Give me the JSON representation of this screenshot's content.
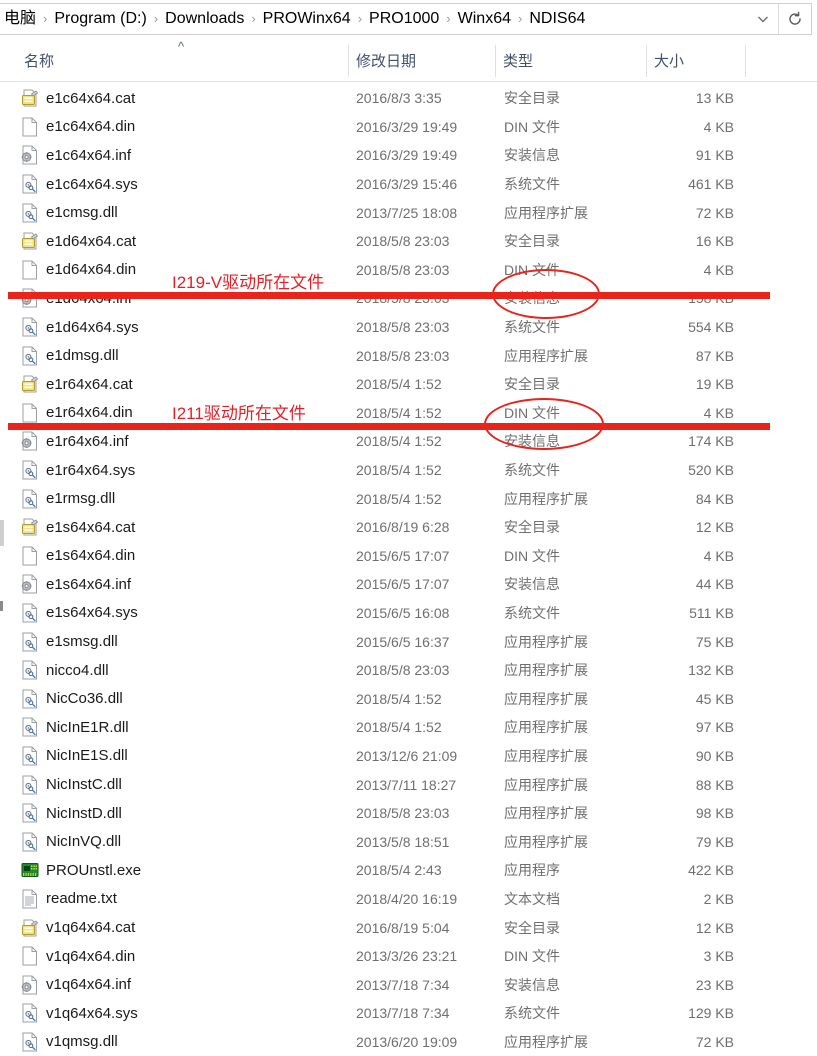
{
  "window": {
    "title": "NDIS64",
    "addressbar": {
      "crumbs": [
        "电脑",
        "Program (D:)",
        "Downloads",
        "PROWinx64",
        "PRO1000",
        "Winx64",
        "NDIS64"
      ],
      "separator": "›",
      "chevron_icon": "chevron-down-icon",
      "refresh_icon": "refresh-icon",
      "refresh_glyph": "↻",
      "chevron_glyph": "⌄"
    }
  },
  "columns": {
    "headers": [
      {
        "label": "名称",
        "key": "name"
      },
      {
        "label": "修改日期",
        "key": "date"
      },
      {
        "label": "类型",
        "key": "type"
      },
      {
        "label": "大小",
        "key": "size"
      }
    ],
    "sort_indicator": "^",
    "sorted_by": "名称",
    "sort_direction": "ascending"
  },
  "files": [
    {
      "name": "e1c64x64.cat",
      "date": "2016/8/3 3:35",
      "type": "安全目录",
      "size": "13 KB",
      "icon": "catalog-file-icon"
    },
    {
      "name": "e1c64x64.din",
      "date": "2016/3/29 19:49",
      "type": "DIN 文件",
      "size": "4 KB",
      "icon": "blank-file-icon"
    },
    {
      "name": "e1c64x64.inf",
      "date": "2016/3/29 19:49",
      "type": "安装信息",
      "size": "91 KB",
      "icon": "setup-info-file-icon"
    },
    {
      "name": "e1c64x64.sys",
      "date": "2016/3/29 15:46",
      "type": "系统文件",
      "size": "461 KB",
      "icon": "system-file-icon"
    },
    {
      "name": "e1cmsg.dll",
      "date": "2013/7/25 18:08",
      "type": "应用程序扩展",
      "size": "72 KB",
      "icon": "system-file-icon"
    },
    {
      "name": "e1d64x64.cat",
      "date": "2018/5/8 23:03",
      "type": "安全目录",
      "size": "16 KB",
      "icon": "catalog-file-icon"
    },
    {
      "name": "e1d64x64.din",
      "date": "2018/5/8 23:03",
      "type": "DIN 文件",
      "size": "4 KB",
      "icon": "blank-file-icon"
    },
    {
      "name": "e1d64x64.inf",
      "date": "2018/5/8 23:03",
      "type": "安装信息",
      "size": "158 KB",
      "icon": "setup-info-file-icon"
    },
    {
      "name": "e1d64x64.sys",
      "date": "2018/5/8 23:03",
      "type": "系统文件",
      "size": "554 KB",
      "icon": "system-file-icon"
    },
    {
      "name": "e1dmsg.dll",
      "date": "2018/5/8 23:03",
      "type": "应用程序扩展",
      "size": "87 KB",
      "icon": "system-file-icon"
    },
    {
      "name": "e1r64x64.cat",
      "date": "2018/5/4 1:52",
      "type": "安全目录",
      "size": "19 KB",
      "icon": "catalog-file-icon"
    },
    {
      "name": "e1r64x64.din",
      "date": "2018/5/4 1:52",
      "type": "DIN 文件",
      "size": "4 KB",
      "icon": "blank-file-icon"
    },
    {
      "name": "e1r64x64.inf",
      "date": "2018/5/4 1:52",
      "type": "安装信息",
      "size": "174 KB",
      "icon": "setup-info-file-icon"
    },
    {
      "name": "e1r64x64.sys",
      "date": "2018/5/4 1:52",
      "type": "系统文件",
      "size": "520 KB",
      "icon": "system-file-icon"
    },
    {
      "name": "e1rmsg.dll",
      "date": "2018/5/4 1:52",
      "type": "应用程序扩展",
      "size": "84 KB",
      "icon": "system-file-icon"
    },
    {
      "name": "e1s64x64.cat",
      "date": "2016/8/19 6:28",
      "type": "安全目录",
      "size": "12 KB",
      "icon": "catalog-file-icon"
    },
    {
      "name": "e1s64x64.din",
      "date": "2015/6/5 17:07",
      "type": "DIN 文件",
      "size": "4 KB",
      "icon": "blank-file-icon"
    },
    {
      "name": "e1s64x64.inf",
      "date": "2015/6/5 17:07",
      "type": "安装信息",
      "size": "44 KB",
      "icon": "setup-info-file-icon"
    },
    {
      "name": "e1s64x64.sys",
      "date": "2015/6/5 16:08",
      "type": "系统文件",
      "size": "511 KB",
      "icon": "system-file-icon"
    },
    {
      "name": "e1smsg.dll",
      "date": "2015/6/5 16:37",
      "type": "应用程序扩展",
      "size": "75 KB",
      "icon": "system-file-icon"
    },
    {
      "name": "nicco4.dll",
      "date": "2018/5/8 23:03",
      "type": "应用程序扩展",
      "size": "132 KB",
      "icon": "system-file-icon"
    },
    {
      "name": "NicCo36.dll",
      "date": "2018/5/4 1:52",
      "type": "应用程序扩展",
      "size": "45 KB",
      "icon": "system-file-icon"
    },
    {
      "name": "NicInE1R.dll",
      "date": "2018/5/4 1:52",
      "type": "应用程序扩展",
      "size": "97 KB",
      "icon": "system-file-icon"
    },
    {
      "name": "NicInE1S.dll",
      "date": "2013/12/6 21:09",
      "type": "应用程序扩展",
      "size": "90 KB",
      "icon": "system-file-icon"
    },
    {
      "name": "NicInstC.dll",
      "date": "2013/7/11 18:27",
      "type": "应用程序扩展",
      "size": "88 KB",
      "icon": "system-file-icon"
    },
    {
      "name": "NicInstD.dll",
      "date": "2018/5/8 23:03",
      "type": "应用程序扩展",
      "size": "98 KB",
      "icon": "system-file-icon"
    },
    {
      "name": "NicInVQ.dll",
      "date": "2013/5/8 18:51",
      "type": "应用程序扩展",
      "size": "79 KB",
      "icon": "system-file-icon"
    },
    {
      "name": "PROUnstl.exe",
      "date": "2018/5/4 2:43",
      "type": "应用程序",
      "size": "422 KB",
      "icon": "network-card-exe-icon"
    },
    {
      "name": "readme.txt",
      "date": "2018/4/20 16:19",
      "type": "文本文档",
      "size": "2 KB",
      "icon": "text-file-icon"
    },
    {
      "name": "v1q64x64.cat",
      "date": "2016/8/19 5:04",
      "type": "安全目录",
      "size": "12 KB",
      "icon": "catalog-file-icon"
    },
    {
      "name": "v1q64x64.din",
      "date": "2013/3/26 23:21",
      "type": "DIN 文件",
      "size": "3 KB",
      "icon": "blank-file-icon"
    },
    {
      "name": "v1q64x64.inf",
      "date": "2013/7/18 7:34",
      "type": "安装信息",
      "size": "23 KB",
      "icon": "setup-info-file-icon"
    },
    {
      "name": "v1q64x64.sys",
      "date": "2013/7/18 7:34",
      "type": "系统文件",
      "size": "129 KB",
      "icon": "system-file-icon"
    },
    {
      "name": "v1qmsg.dll",
      "date": "2013/6/20 19:09",
      "type": "应用程序扩展",
      "size": "72 KB",
      "icon": "system-file-icon"
    }
  ],
  "annotations": {
    "color": "#e8241b",
    "items": [
      {
        "label": "I219-V驱动所在文件",
        "target_file": "e1d64x64.inf",
        "circled_value": "安装信息"
      },
      {
        "label": "I211驱动所在文件",
        "target_file": "e1r64x64.inf",
        "circled_value": "安装信息"
      }
    ]
  }
}
